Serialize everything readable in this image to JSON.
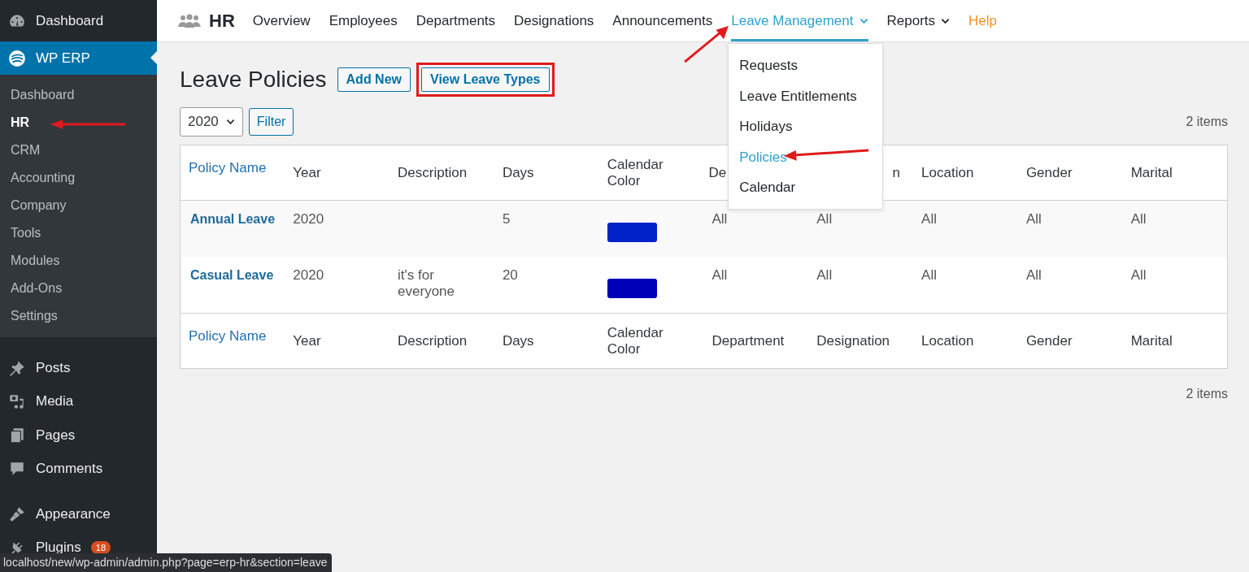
{
  "sidebar": {
    "top_items": [
      {
        "label": "Dashboard",
        "selected": false
      },
      {
        "label": "WP ERP",
        "selected": true
      }
    ],
    "submenu": [
      {
        "label": "Dashboard",
        "selected": false
      },
      {
        "label": "HR",
        "selected": true
      },
      {
        "label": "CRM",
        "selected": false
      },
      {
        "label": "Accounting",
        "selected": false
      },
      {
        "label": "Company",
        "selected": false
      },
      {
        "label": "Tools",
        "selected": false
      },
      {
        "label": "Modules",
        "selected": false
      },
      {
        "label": "Add-Ons",
        "selected": false
      },
      {
        "label": "Settings",
        "selected": false
      }
    ],
    "items": [
      {
        "label": "Posts"
      },
      {
        "label": "Media"
      },
      {
        "label": "Pages"
      },
      {
        "label": "Comments"
      },
      {
        "label": "Appearance"
      },
      {
        "label": "Plugins",
        "badge": "18"
      }
    ]
  },
  "topnav": {
    "title": "HR",
    "tabs": [
      {
        "label": "Overview",
        "kind": "link",
        "selected": false
      },
      {
        "label": "Employees",
        "kind": "link",
        "selected": false
      },
      {
        "label": "Departments",
        "kind": "link",
        "selected": false
      },
      {
        "label": "Designations",
        "kind": "link",
        "selected": false
      },
      {
        "label": "Announcements",
        "kind": "link",
        "selected": false
      },
      {
        "label": "Leave Management",
        "kind": "menu",
        "selected": true
      },
      {
        "label": "Reports",
        "kind": "menu",
        "selected": false
      },
      {
        "label": "Help",
        "kind": "help",
        "selected": false
      }
    ]
  },
  "dropdown": [
    {
      "label": "Requests",
      "selected": false
    },
    {
      "label": "Leave Entitlements",
      "selected": false
    },
    {
      "label": "Holidays",
      "selected": false
    },
    {
      "label": "Policies",
      "selected": true
    },
    {
      "label": "Calendar",
      "selected": false
    }
  ],
  "page_title": "Leave Policies",
  "buttons": [
    {
      "label": "Add New",
      "highlighted": false
    },
    {
      "label": "View Leave Types",
      "highlighted": true
    }
  ],
  "year_select": "2020",
  "filter_button": "Filter",
  "item_count_top": "2 items",
  "item_count_bottom": "2 items",
  "table": {
    "header": [
      "Policy Name",
      "Year",
      "Description",
      "Days",
      "Calendar Color",
      "De",
      "n",
      "Location",
      "Gender",
      "Marital"
    ],
    "footer": [
      "Policy Name",
      "Year",
      "Description",
      "Days",
      "Calendar Color",
      "Department",
      "Designation",
      "Location",
      "Gender",
      "Marital"
    ],
    "rows": [
      {
        "name": "Annual Leave",
        "year": "2020",
        "days": "5",
        "color": "#0022c8",
        "department": "All",
        "designation": "All",
        "location": "All",
        "gender": "All",
        "marital": "All"
      },
      {
        "name": "Casual Leave",
        "year": "2020",
        "description": "it's for everyone",
        "days": "20",
        "color": "#0000b8",
        "department": "All",
        "designation": "All",
        "location": "All",
        "gender": "All",
        "marital": "All"
      }
    ]
  },
  "status_url": "localhost/new/wp-admin/admin.php?page=erp-hr&section=leave"
}
